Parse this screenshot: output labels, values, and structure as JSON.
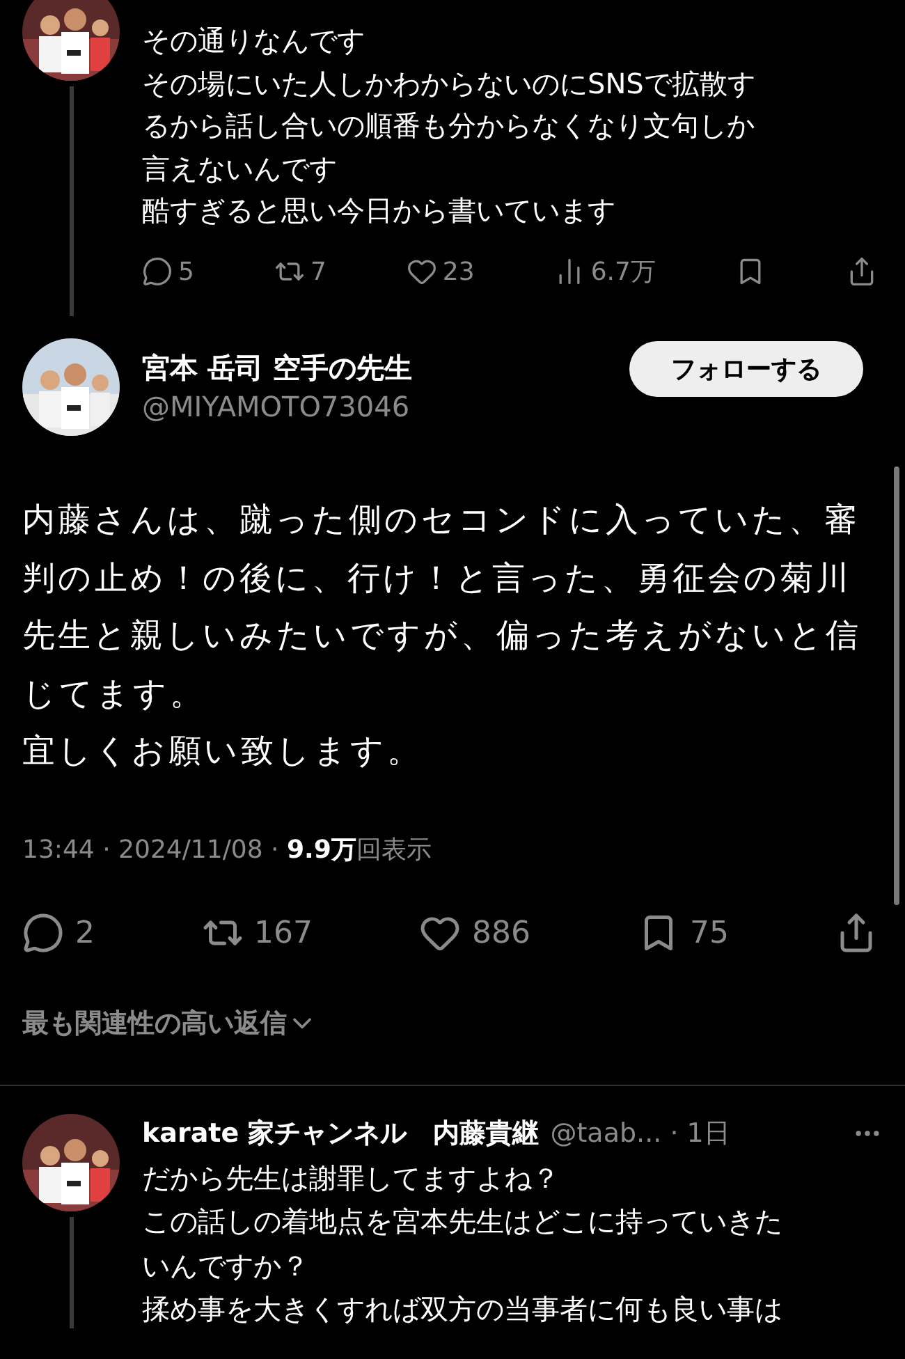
{
  "previous_reply": {
    "body_lines": [
      "その通りなんです",
      "その場にいた人しかわからないのにSNSで拡散す",
      "るから話し合いの順番も分からなくなり文句しか",
      "言えないんです",
      "酷すぎると思い今日から書いています"
    ],
    "actions": [
      {
        "kind": "reply",
        "count": "5"
      },
      {
        "kind": "repost",
        "count": "7"
      },
      {
        "kind": "like",
        "count": "23"
      },
      {
        "kind": "views",
        "count": "6.7万"
      },
      {
        "kind": "bookmark"
      },
      {
        "kind": "share"
      }
    ]
  },
  "main_tweet": {
    "name": "宮本 岳司 空手の先生",
    "handle": "@MIYAMOTO73046",
    "follow_button": "フォローする",
    "body_lines": [
      "内藤さんは、蹴った側のセコンドに入っていた、審",
      "判の止め！の後に、行け！と言った、勇征会の菊川",
      "先生と親しいみたいですが、偏った考えがないと信",
      "じてます。",
      "宜しくお願い致します。"
    ],
    "timestamp": "13:44 · 2024/11/08 · ",
    "views_count": "9.9万",
    "views_label": "回表示",
    "actions": [
      {
        "kind": "reply",
        "count": "2"
      },
      {
        "kind": "repost",
        "count": "167"
      },
      {
        "kind": "like",
        "count": "886"
      },
      {
        "kind": "bookmark",
        "count": "75"
      },
      {
        "kind": "share"
      }
    ]
  },
  "sort_label": "最も関連性の高い返信",
  "reply": {
    "name": "karate 家チャンネル　内藤貴継",
    "handle": "@taab...",
    "time": " · 1日",
    "body_lines": [
      "だから先生は謝罪してますよね？",
      "この話しの着地点を宮本先生はどこに持っていきた",
      "いんですか？",
      "揉め事を大きくすれば双方の当事者に何も良い事は"
    ]
  }
}
